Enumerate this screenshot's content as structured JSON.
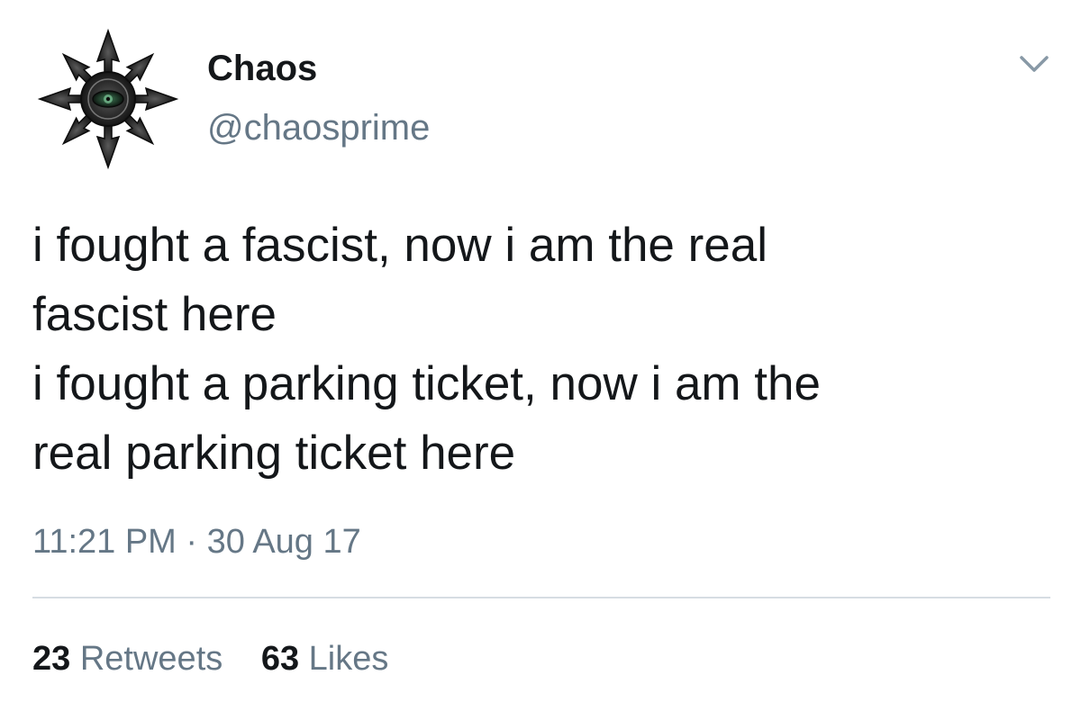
{
  "tweet": {
    "author": {
      "display_name": "Chaos",
      "handle": "@chaosprime",
      "avatar_icon": "chaos-star-icon"
    },
    "menu_icon": "chevron-down-icon",
    "text_lines": [
      "i fought a fascist, now i am the real",
      "fascist here",
      "i fought a parking ticket, now i am the",
      "real parking ticket here"
    ],
    "timestamp": "11:21 PM · 30 Aug 17",
    "stats": {
      "retweets_count": "23",
      "retweets_label": "Retweets",
      "likes_count": "63",
      "likes_label": "Likes"
    }
  },
  "colors": {
    "primary_text": "#14171a",
    "secondary_text": "#657786",
    "divider": "#d6dde3",
    "background": "#ffffff"
  }
}
